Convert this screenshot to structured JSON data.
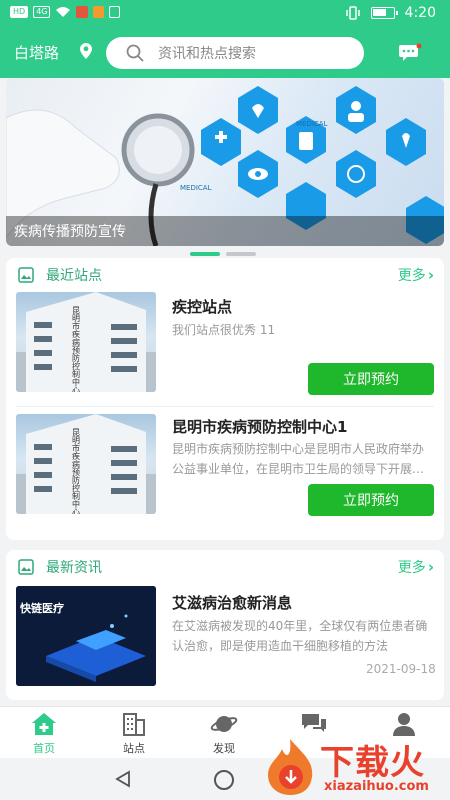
{
  "status_bar": {
    "time": "4:20",
    "signal_badges": [
      "HD",
      "4G"
    ]
  },
  "header": {
    "location": "白塔路",
    "search_placeholder": "资讯和热点搜索",
    "icons": [
      "location-pin-icon",
      "search-icon",
      "message-icon"
    ]
  },
  "banner": {
    "caption": "疾病传播预防宣传",
    "art_labels": [
      "MEDICAL",
      "MEDICAL"
    ],
    "page_count": 2,
    "active_page": 1
  },
  "stations": {
    "title": "最近站点",
    "more": "更多",
    "items": [
      {
        "title": "疾控站点",
        "desc": "我们站点很优秀 11",
        "button": "立即预约",
        "thumb_text": "昆明市疾病预防控制中心"
      },
      {
        "title": "昆明市疾病预防控制中心1",
        "desc": "昆明市疾病预防控制中心是昆明市人民政府举办公益事业单位，在昆明市卫生局的领导下开展工作",
        "button": "立即预约",
        "thumb_text": "昆明市疾病预防控制中心"
      }
    ]
  },
  "news": {
    "title": "最新资讯",
    "more": "更多",
    "items": [
      {
        "title": "艾滋病治愈新消息",
        "desc": "在艾滋病被发现的40年里，全球仅有两位患者确认治愈，即是使用造血干细胞移植的方法",
        "date": "2021-09-18",
        "thumb_text": "快链医疗"
      }
    ]
  },
  "bottom_nav": {
    "items": [
      {
        "label": "首页",
        "icon": "home-plus-icon",
        "active": true
      },
      {
        "label": "站点",
        "icon": "building-icon",
        "active": false
      },
      {
        "label": "发现",
        "icon": "planet-icon",
        "active": false
      },
      {
        "label": "",
        "icon": "chat-bubbles-icon",
        "active": false
      },
      {
        "label": "",
        "icon": "user-icon",
        "active": false
      }
    ]
  },
  "watermark": {
    "brand": "下载火",
    "url": "xiazaihuo.com"
  },
  "colors": {
    "primary": "#2ecb8a",
    "button": "#1fb82c",
    "watermark": "#e8412c"
  }
}
